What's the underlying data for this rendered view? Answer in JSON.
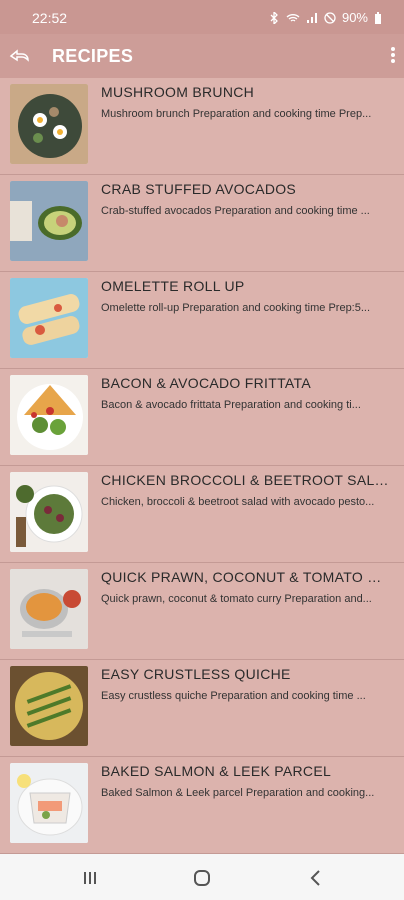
{
  "status_bar": {
    "time": "22:52",
    "battery": "90%"
  },
  "appbar": {
    "title": "RECIPES"
  },
  "recipes": [
    {
      "title": "MUSHROOM BRUNCH",
      "desc": "Mushroom brunch   Preparation and cooking time Prep..."
    },
    {
      "title": "CRAB STUFFED AVOCADOS",
      "desc": "Crab-stuffed avocados   Preparation and cooking time ..."
    },
    {
      "title": "OMELETTE ROLL UP",
      "desc": "Omelette roll-up   Preparation and cooking time Prep:5..."
    },
    {
      "title": "BACON & AVOCADO FRITTATA",
      "desc": "Bacon & avocado frittata   Preparation and cooking ti..."
    },
    {
      "title": "CHICKEN BROCCOLI & BEETROOT SALAD",
      "desc": "Chicken, broccoli & beetroot salad with avocado pesto..."
    },
    {
      "title": "QUICK PRAWN, COCONUT & TOMATO CUR...",
      "desc": "Quick prawn, coconut & tomato curry   Preparation and..."
    },
    {
      "title": "EASY CRUSTLESS QUICHE",
      "desc": "Easy crustless quiche   Preparation and cooking time ..."
    },
    {
      "title": "BAKED SALMON & LEEK PARCEL",
      "desc": "Baked Salmon & Leek parcel   Preparation and cooking..."
    }
  ],
  "colors": {
    "background": "#dcb3ad",
    "appbar": "#cd9d98",
    "status": "#c99792"
  },
  "icons": {
    "back": "back-arrow-icon",
    "more": "more-vert-icon",
    "recents": "recents-icon",
    "home": "home-icon",
    "nav_back": "nav-back-icon"
  }
}
